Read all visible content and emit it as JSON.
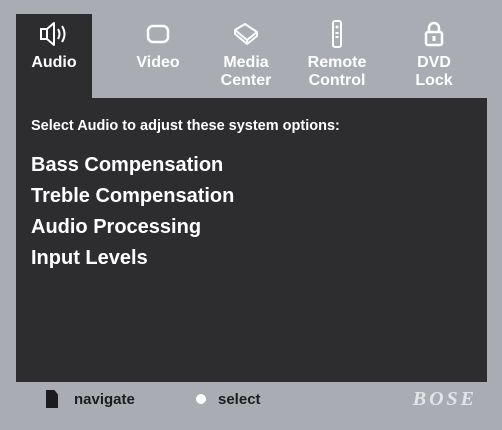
{
  "tabs": [
    {
      "label_line1": "Audio",
      "label_line2": "",
      "icon": "speaker-icon",
      "active": true
    },
    {
      "label_line1": "Video",
      "label_line2": "",
      "icon": "tv-icon",
      "active": false
    },
    {
      "label_line1": "Media",
      "label_line2": "Center",
      "icon": "media-center-icon",
      "active": false
    },
    {
      "label_line1": "Remote",
      "label_line2": "Control",
      "icon": "remote-icon",
      "active": false
    },
    {
      "label_line1": "DVD",
      "label_line2": "Lock",
      "icon": "lock-icon",
      "active": false
    }
  ],
  "main": {
    "instruction": "Select Audio to adjust these system options:",
    "options": [
      "Bass Compensation",
      "Treble Compensation",
      "Audio Processing",
      "Input Levels"
    ]
  },
  "footer": {
    "navigate_label": "navigate",
    "select_label": "select",
    "brand": "BOSE"
  },
  "colors": {
    "screen_bg": "#2d2d30",
    "frame_bg": "#a9acb2",
    "text": "#ffffff"
  }
}
